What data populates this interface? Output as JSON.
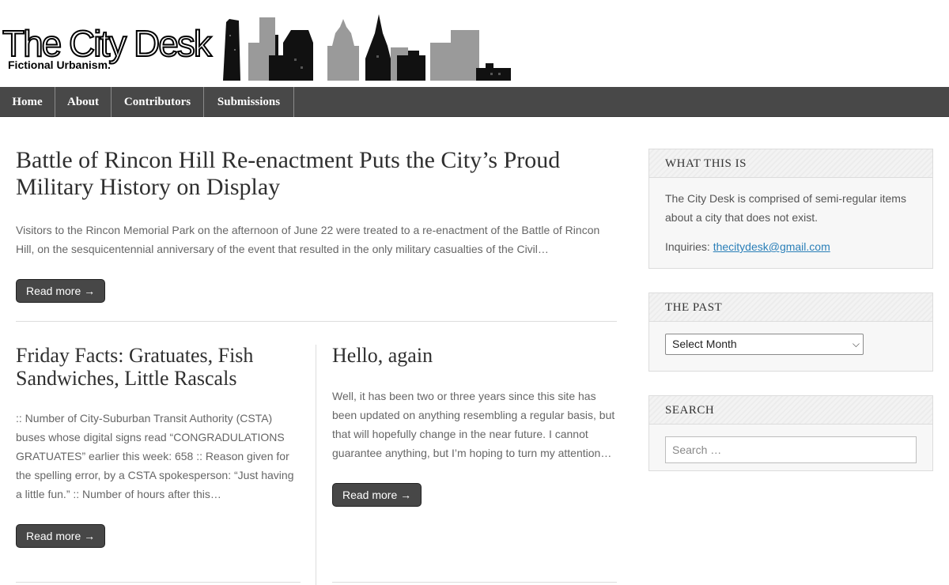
{
  "site": {
    "title": "The City Desk",
    "tagline": "Fictional Urbanism."
  },
  "nav": {
    "items": [
      {
        "label": "Home"
      },
      {
        "label": "About"
      },
      {
        "label": "Contributors"
      },
      {
        "label": "Submissions"
      }
    ]
  },
  "posts": [
    {
      "title": "Battle of Rincon Hill Re-enactment Puts the City’s Proud Military History on Display",
      "excerpt": "Visitors to the Rincon Memorial Park on the afternoon of June 22 were treated to a re-enactment of the Battle of Rincon Hill, on the sesquicentennial anniversary of the event that resulted in the only military casualties of the Civil…",
      "read_more": "Read more →"
    },
    {
      "title": "Friday Facts: Gratuates, Fish Sandwiches, Little Rascals",
      "excerpt": ":: Number of City-Suburban Transit Authority (CSTA) buses whose digital signs read “CONGRADULATIONS GRATUATES” earlier this week: 658 :: Reason given for the spelling error, by a CSTA spokesperson: “Just having a little fun.” :: Number of hours after this…",
      "read_more": "Read more →"
    },
    {
      "title": "Hello, again",
      "excerpt": "Well, it has been two or three years since this site has been updated on anything resembling a regular basis, but that will hopefully change in the near future. I cannot guarantee anything, but I’m hoping to turn my attention…",
      "read_more": "Read more →"
    }
  ],
  "sidebar": {
    "about": {
      "heading": "WHAT THIS IS",
      "text": "The City Desk is comprised of semi-regular items about a city that does not exist.",
      "inquiries_label": "Inquiries:",
      "email": "thecitydesk@gmail.com"
    },
    "archive": {
      "heading": "THE PAST",
      "select_value": "Select Month"
    },
    "search": {
      "heading": "SEARCH",
      "placeholder": "Search …"
    }
  },
  "colors": {
    "nav_bg": "#484848",
    "button_bg": "#474747",
    "link": "#2a7fb8",
    "skyline_dark": "#111111",
    "skyline_light": "#9a9a9a"
  }
}
